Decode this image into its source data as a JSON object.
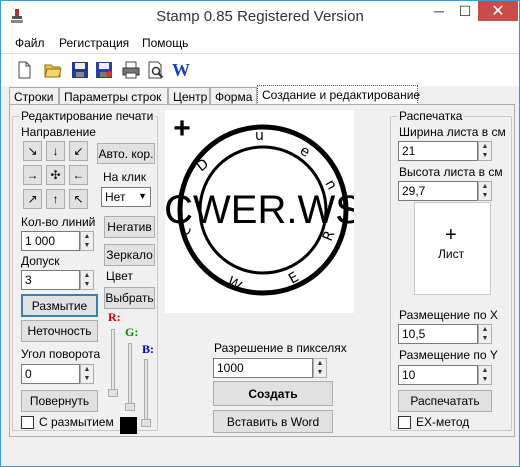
{
  "window": {
    "title": "Stamp 0.85 Registered Version",
    "min_glyph": "─",
    "max_glyph": "☐",
    "close_glyph": "✕"
  },
  "menu": [
    "Файл",
    "Регистрация",
    "Помощь"
  ],
  "toolbar": {
    "word_label": "W"
  },
  "tabs": [
    "Строки",
    "Параметры строк",
    "Центр",
    "Форма",
    "Создание и редактирование"
  ],
  "edit": {
    "group_title": "Редактирование печати",
    "direction_label": "Направление",
    "arrows": [
      "↘",
      "↓",
      "↙",
      "→",
      "✣",
      "←",
      "↗",
      "↑",
      "↖"
    ],
    "auto_cor": "Авто. кор.",
    "on_click_label": "На клик",
    "on_click_value": "Нет",
    "lines_label": "Кол-во линий",
    "lines_value": "1 000",
    "tolerance_label": "Допуск",
    "tolerance_value": "3",
    "negative": "Негатив",
    "mirror": "Зеркало",
    "color_label": "Цвет",
    "choose": "Выбрать",
    "blur": "Размытие",
    "inaccuracy": "Неточность",
    "angle_label": "Угол поворота",
    "angle_value": "0",
    "rotate": "Повернуть",
    "with_blur": "С размытием",
    "r": "R:",
    "g": "G:",
    "b": "B:",
    "colors": {
      "r": "#cc0000",
      "g": "#008800",
      "b": "#0000cc"
    }
  },
  "stamp": {
    "plus": "+",
    "center_text": "CWER.WS",
    "ring_letters": [
      "C",
      "D",
      "u",
      "e",
      "n",
      "R",
      "E",
      "W"
    ]
  },
  "center": {
    "resolution_label": "Разрешение в пикселях",
    "resolution_value": "1000",
    "create": "Создать",
    "insert_word": "Вставить в Word"
  },
  "print": {
    "group_title": "Распечатка",
    "width_label": "Ширина листа в см",
    "width_value": "21",
    "height_label": "Высота листа в см",
    "height_value": "29,7",
    "sheet_label": "Лист",
    "pos_x_label": "Размещение по X",
    "pos_x_value": "10,5",
    "pos_y_label": "Размещение по Y",
    "pos_y_value": "10",
    "print_btn": "Распечатать",
    "ex_method": "EX-метод"
  }
}
